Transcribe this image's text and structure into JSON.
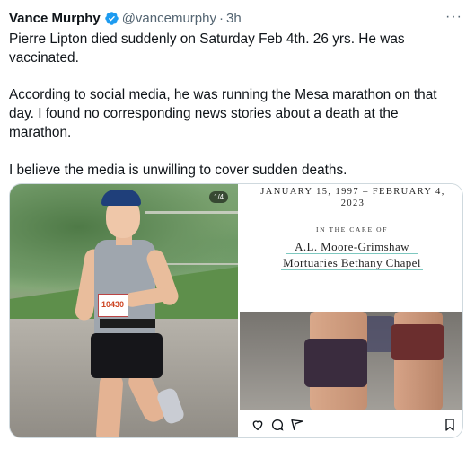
{
  "author": {
    "name": "Vance Murphy",
    "handle": "@vancemurphy",
    "separator": "·",
    "time": "3h",
    "verified": true,
    "verified_icon": "verified-badge-icon",
    "accent_color": "#1d9bf0"
  },
  "more_label": "···",
  "tweet": {
    "text": "Pierre Lipton died suddenly on Saturday Feb 4th. 26 yrs. He was vaccinated.\n\nAccording to social media, he was running the Mesa marathon on that day. I found no corresponding news stories about a death at the marathon.\n\nI believe the media is unwilling to cover sudden deaths."
  },
  "media": {
    "page_indicator": "1/4",
    "bib_number": "10430",
    "obituary": {
      "dates": "JANUARY 15, 1997  –  FEBRUARY 4, 2023",
      "care_of": "IN THE CARE OF",
      "line1": "A.L. Moore-Grimshaw",
      "line2": "Mortuaries Bethany Chapel"
    },
    "actions": [
      {
        "icon": "heart-icon"
      },
      {
        "icon": "comment-icon"
      },
      {
        "icon": "share-icon"
      },
      {
        "icon": "bookmark-icon"
      }
    ]
  }
}
